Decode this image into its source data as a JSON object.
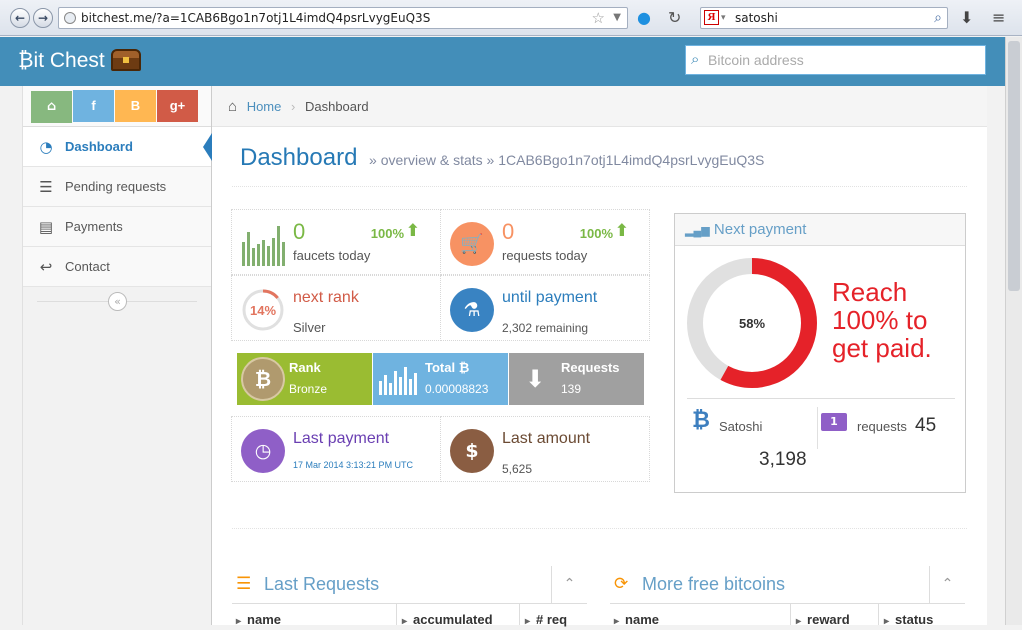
{
  "browser": {
    "url": "bitchest.me/?a=1CAB6Bgo1n7otj1L4imdQ4psrLvygEuQ3S",
    "search_value": "satoshi"
  },
  "header": {
    "brand_prefix": "₿",
    "brand_text": "it Chest",
    "address_placeholder": "Bitcoin address"
  },
  "sidebar": {
    "shortcuts": [
      {
        "name": "home",
        "color": "#87b87f"
      },
      {
        "name": "facebook",
        "color": "#6fb3e0"
      },
      {
        "name": "blogger",
        "color": "#ffb752"
      },
      {
        "name": "google-plus",
        "color": "#d15b47"
      }
    ],
    "items": [
      {
        "label": "Dashboard",
        "icon": "dashboard-icon",
        "active": true
      },
      {
        "label": "Pending requests",
        "icon": "list-icon"
      },
      {
        "label": "Payments",
        "icon": "list-alt-icon"
      },
      {
        "label": "Contact",
        "icon": "reply-icon"
      }
    ]
  },
  "breadcrumb": {
    "home": "Home",
    "current": "Dashboard"
  },
  "page": {
    "title": "Dashboard",
    "subtitle": "» overview & stats » 1CAB6Bgo1n7otj1L4imdQ4psrLvygEuQ3S"
  },
  "stats": {
    "faucets": {
      "value": "0",
      "label": "faucets today",
      "pct": "100%"
    },
    "requests": {
      "value": "0",
      "label": "requests today",
      "pct": "100%"
    },
    "next_rank": {
      "pct": "14%",
      "title": "next rank",
      "sub": "Silver",
      "progress": 0.14
    },
    "until_payment": {
      "title": "until payment",
      "sub": "2,302 remaining"
    },
    "last_payment": {
      "title": "Last payment",
      "sub": "17 Mar 2014 3:13:21 PM UTC"
    },
    "last_amount": {
      "title": "Last amount",
      "sub": "5,625"
    }
  },
  "tiles": [
    {
      "title": "Rank",
      "value": "Bronze",
      "color": "#9abc32"
    },
    {
      "title": "Total ₿",
      "value": "0.00008823",
      "color": "#6fb3e0"
    },
    {
      "title": "Requests",
      "value": "139",
      "color": "#a0a0a0"
    }
  ],
  "next_payment": {
    "title": "Next payment",
    "pct": "58%",
    "progress": 0.58,
    "message": "Reach 100% to get paid.",
    "satoshi_label": "Satoshi",
    "satoshi_value": "3,198",
    "requests_label": "requests",
    "requests_value": "45"
  },
  "last_requests": {
    "title": "Last Requests",
    "columns": [
      "name",
      "accumulated",
      "# req"
    ]
  },
  "more_free": {
    "title": "More free bitcoins",
    "columns": [
      "name",
      "reward",
      "status"
    ]
  },
  "colors": {
    "primary": "#438eb9",
    "green": "#7ab845",
    "red": "#e52229",
    "orange": "#f89406"
  }
}
